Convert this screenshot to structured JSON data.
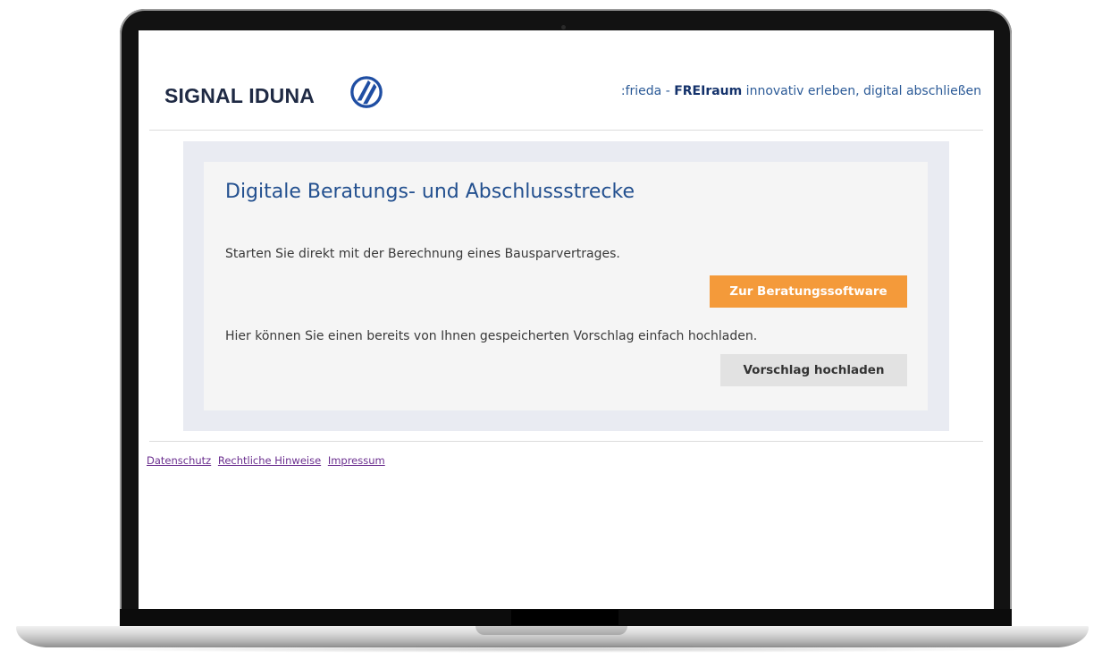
{
  "header": {
    "logo_text": "SIGNAL IDUNA",
    "logo_icon": "signal-iduna-logo-icon",
    "tagline_prefix": ":frieda - ",
    "tagline_strong": "FREIraum",
    "tagline_suffix": " innovativ erleben, digital abschließen"
  },
  "panel": {
    "title": "Digitale Beratungs- und Abschlussstrecke",
    "text_start": "Starten Sie direkt mit der Berechnung eines Bausparvertrages.",
    "button_primary": "Zur Beratungssoftware",
    "text_upload": "Hier können Sie einen bereits von Ihnen gespeicherten Vorschlag einfach hochladen.",
    "button_secondary": "Vorschlag hochladen"
  },
  "footer": {
    "links": [
      "Datenschutz",
      "Rechtliche Hinweise",
      "Impressum"
    ]
  },
  "colors": {
    "brand_blue": "#23508f",
    "accent_orange": "#f49a3a",
    "link_purple": "#6b2f8f"
  }
}
